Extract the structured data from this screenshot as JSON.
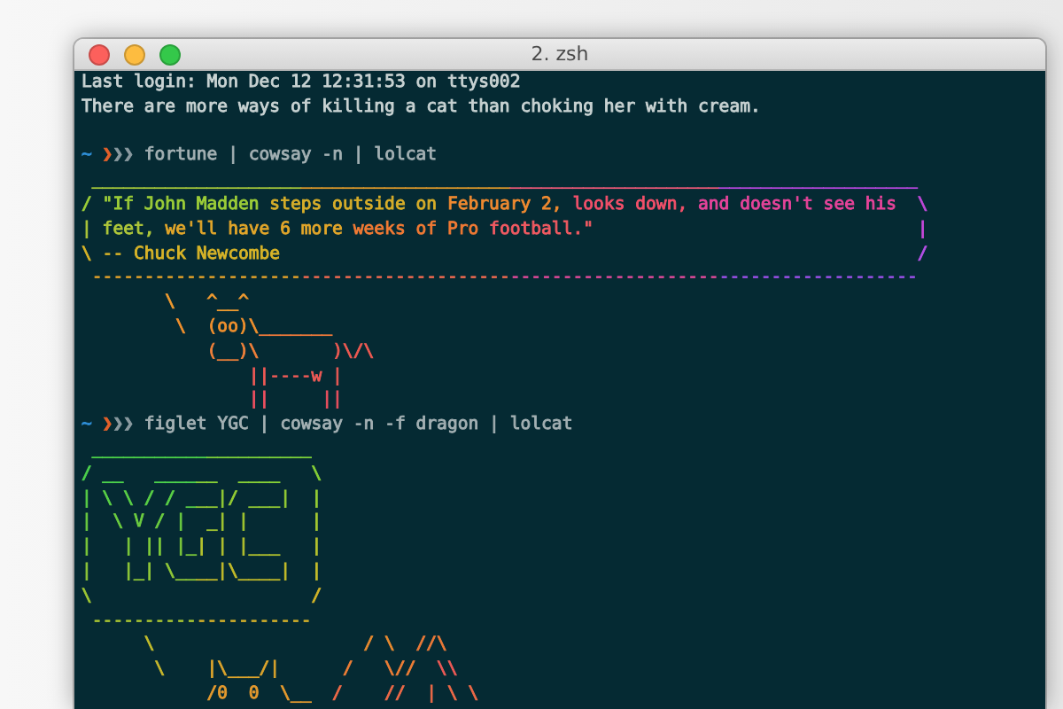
{
  "window": {
    "title": "2. zsh"
  },
  "lines": [
    {
      "kind": "text",
      "segments": [
        {
          "text": "Last login: Mon Dec 12 12:31:53 on ttys002",
          "color": "#c9d3d3"
        }
      ]
    },
    {
      "kind": "text",
      "segments": [
        {
          "text": "There are more ways of killing a cat than choking her with cream.",
          "color": "#c9d3d3"
        }
      ]
    },
    {
      "kind": "blank"
    },
    {
      "kind": "prompt",
      "segments": [
        {
          "text": "~ ",
          "color": "#2f8fd8"
        },
        {
          "text": "❯",
          "color": "#e2602a"
        },
        {
          "text": "❯❯ ",
          "color": "#8a9aa0"
        },
        {
          "text": "fortune | cowsay -n | lolcat",
          "color": "#a3b0b3"
        }
      ]
    },
    {
      "kind": "text",
      "segments": [
        {
          "text": " ____________________",
          "color": "#a6c83a"
        },
        {
          "text": "____________________",
          "color": "#e09a2a"
        },
        {
          "text": "____________________",
          "color": "#ee5a78"
        },
        {
          "text": "___________________",
          "color": "#b848e0"
        }
      ]
    },
    {
      "kind": "text",
      "segments": [
        {
          "text": "/ \"If John Madden ",
          "color": "#9ccd38"
        },
        {
          "text": "steps outside on ",
          "color": "#d8ae2a"
        },
        {
          "text": "February 2, ",
          "color": "#f08a30"
        },
        {
          "text": "looks down, ",
          "color": "#f2506a"
        },
        {
          "text": "and doesn't see his",
          "color": "#e6449a"
        },
        {
          "text": "  \\",
          "color": "#c048d8"
        }
      ]
    },
    {
      "kind": "text",
      "segments": [
        {
          "text": "| feet, ",
          "color": "#b0c83a"
        },
        {
          "text": "we'll have 6 more ",
          "color": "#e2a62a"
        },
        {
          "text": "weeks of Pro ",
          "color": "#f27a34"
        },
        {
          "text": "football.\"",
          "color": "#f25a62"
        },
        {
          "text": "                               |",
          "color": "#c448d8"
        }
      ]
    },
    {
      "kind": "text",
      "segments": [
        {
          "text": "\\ -- Chuck Newcombe",
          "color": "#d8b428"
        },
        {
          "text": "                                                             /",
          "color": "#b450e6"
        }
      ]
    },
    {
      "kind": "text",
      "segments": [
        {
          "text": " --------------------",
          "color": "#e0a02a"
        },
        {
          "text": "--------------------",
          "color": "#f06a50"
        },
        {
          "text": "--------------------",
          "color": "#e04a9a"
        },
        {
          "text": "-------------------",
          "color": "#9a50e8"
        }
      ]
    },
    {
      "kind": "text",
      "segments": [
        {
          "text": "        \\   ^__^",
          "color": "#ee9a30"
        }
      ]
    },
    {
      "kind": "text",
      "segments": [
        {
          "text": "         \\  (oo)\\",
          "color": "#f0902e"
        },
        {
          "text": "_______",
          "color": "#f07a3a"
        }
      ]
    },
    {
      "kind": "text",
      "segments": [
        {
          "text": "            (__)\\",
          "color": "#f0803a"
        },
        {
          "text": "       )\\/\\",
          "color": "#ee5a52"
        }
      ]
    },
    {
      "kind": "text",
      "segments": [
        {
          "text": "                ||----w |",
          "color": "#ee5a56"
        }
      ]
    },
    {
      "kind": "text",
      "segments": [
        {
          "text": "                ||     ||",
          "color": "#ee5060"
        }
      ]
    },
    {
      "kind": "prompt",
      "segments": [
        {
          "text": "~ ",
          "color": "#2f8fd8"
        },
        {
          "text": "❯",
          "color": "#e2602a"
        },
        {
          "text": "❯❯ ",
          "color": "#8a9aa0"
        },
        {
          "text": "figlet YGC | cowsay -n -f dragon | lolcat",
          "color": "#a3b0b3"
        }
      ]
    },
    {
      "kind": "text",
      "segments": [
        {
          "text": " ___________",
          "color": "#4cd24a"
        },
        {
          "text": "__________",
          "color": "#7cd23a"
        }
      ]
    },
    {
      "kind": "text",
      "segments": [
        {
          "text": "/ __   ____",
          "color": "#4cd04c"
        },
        {
          "text": "__  ____   \\",
          "color": "#86d036"
        }
      ]
    },
    {
      "kind": "text",
      "segments": [
        {
          "text": "| \\ \\ / / _",
          "color": "#5ad046"
        },
        {
          "text": "__|/ ___|  |",
          "color": "#94cc34"
        }
      ]
    },
    {
      "kind": "text",
      "segments": [
        {
          "text": "|  \\ V / | ",
          "color": "#6ccd40"
        },
        {
          "text": " _| |      |",
          "color": "#a4c830"
        }
      ]
    },
    {
      "kind": "text",
      "segments": [
        {
          "text": "|   | || |_",
          "color": "#7ecb3a"
        },
        {
          "text": "| | |___   |",
          "color": "#b4c22e"
        }
      ]
    },
    {
      "kind": "text",
      "segments": [
        {
          "text": "|   |_| \\__",
          "color": "#90c838"
        },
        {
          "text": "__|\\____|  |",
          "color": "#c4bc2a"
        }
      ]
    },
    {
      "kind": "text",
      "segments": [
        {
          "text": "\\          ",
          "color": "#9ec634"
        },
        {
          "text": "           /",
          "color": "#d2b428"
        }
      ]
    },
    {
      "kind": "text",
      "segments": [
        {
          "text": " ----------",
          "color": "#a8c432"
        },
        {
          "text": "-----------",
          "color": "#d4b02a"
        }
      ]
    },
    {
      "kind": "text",
      "segments": [
        {
          "text": "      \\",
          "color": "#c2bc2c"
        },
        {
          "text": "                    / \\",
          "color": "#e88a30"
        },
        {
          "text": "  //\\",
          "color": "#ec7a38"
        }
      ]
    },
    {
      "kind": "text",
      "segments": [
        {
          "text": "       \\",
          "color": "#c8b82c"
        },
        {
          "text": "    |\\___/|",
          "color": "#dca42c"
        },
        {
          "text": "      /   \\//",
          "color": "#ee7e36"
        },
        {
          "text": "  \\\\",
          "color": "#ec5a56"
        }
      ]
    },
    {
      "kind": "text",
      "segments": [
        {
          "text": "            /0  0  \\__",
          "color": "#e49a2e"
        },
        {
          "text": "  /    //  | \\ \\",
          "color": "#ee6a48"
        }
      ]
    }
  ]
}
